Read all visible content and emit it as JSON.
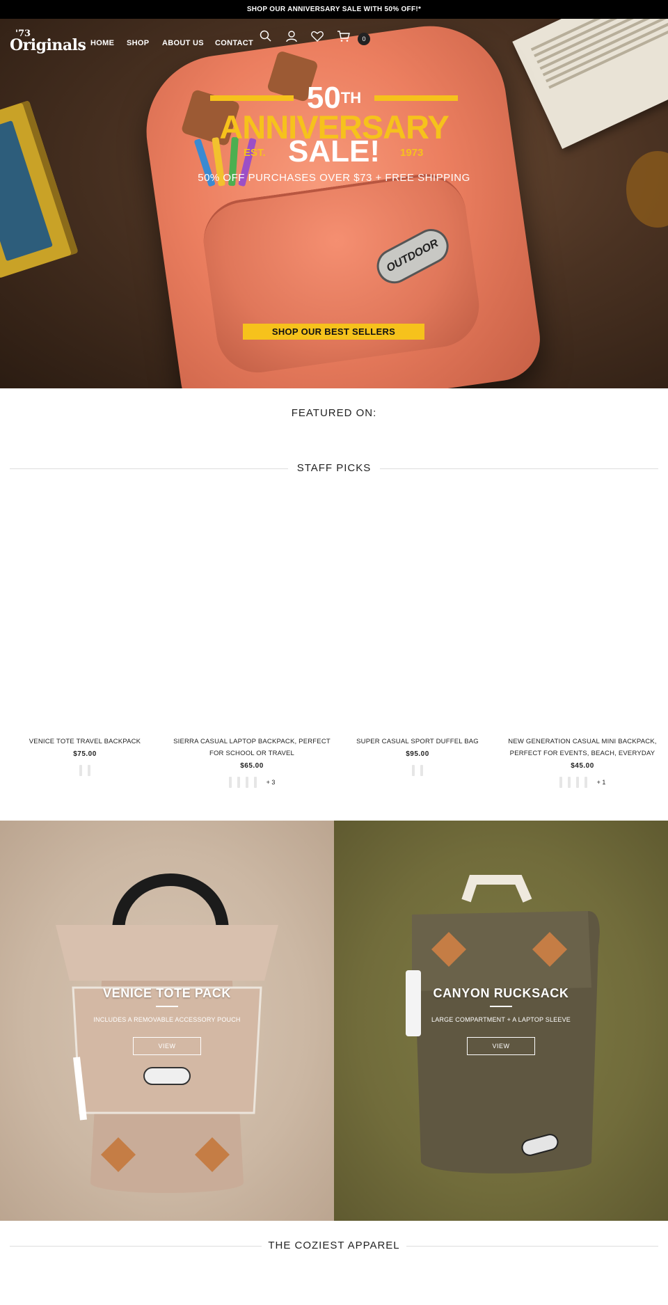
{
  "announcement": "SHOP OUR ANNIVERSARY SALE WITH 50% OFF!*",
  "brand": {
    "small": "'73",
    "big": "Originals"
  },
  "nav": {
    "home": "HOME",
    "shop": "SHOP",
    "about": "ABOUT US",
    "contact": "CONTACT"
  },
  "header_icons": [
    "search-icon",
    "account-icon",
    "wishlist-icon",
    "cart-icon"
  ],
  "cart_count": "0",
  "hero": {
    "fifty": "50",
    "th": "TH",
    "anniversary": "ANNIVERSARY",
    "est": "EST.",
    "sale": "SALE!",
    "year": "1973",
    "subtitle": "50% OFF PURCHASES OVER $73 + FREE SHIPPING",
    "cta": "SHOP OUR BEST SELLERS",
    "bag_logo": "OUTDOOR"
  },
  "featured_on": "FEATURED ON:",
  "staff_picks": {
    "heading": "STAFF PICKS",
    "products": [
      {
        "name": "VENICE TOTE TRAVEL BACKPACK",
        "price": "$75.00",
        "swatches": 2,
        "more": ""
      },
      {
        "name": "SIERRA CASUAL LAPTOP BACKPACK, PERFECT FOR SCHOOL OR TRAVEL",
        "price": "$65.00",
        "swatches": 4,
        "more": "+ 3"
      },
      {
        "name": "SUPER CASUAL SPORT DUFFEL BAG",
        "price": "$95.00",
        "swatches": 2,
        "more": ""
      },
      {
        "name": "NEW GENERATION CASUAL MINI BACKPACK, PERFECT FOR EVENTS, BEACH, EVERYDAY",
        "price": "$45.00",
        "swatches": 4,
        "more": "+ 1"
      }
    ]
  },
  "promos": [
    {
      "title": "VENICE TOTE PACK",
      "desc": "INCLUDES A REMOVABLE ACCESSORY POUCH",
      "button": "VIEW"
    },
    {
      "title": "CANYON RUCKSACK",
      "desc": "LARGE COMPARTMENT + A LAPTOP SLEEVE",
      "button": "VIEW"
    }
  ],
  "coziest": "THE COZIEST APPAREL",
  "colors": {
    "accent": "#f6c21c",
    "announce_bg": "#000000",
    "text": "#222222"
  }
}
